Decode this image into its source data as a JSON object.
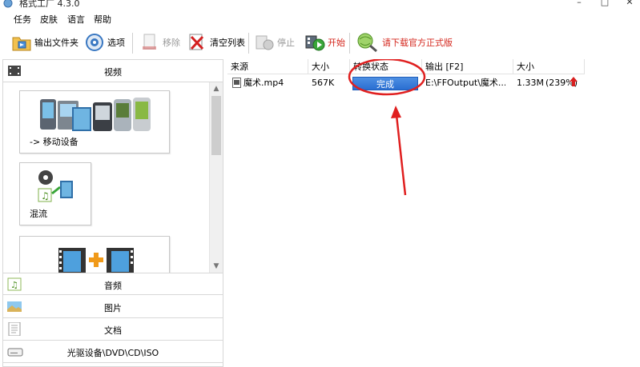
{
  "window": {
    "title": "格式工厂 4.3.0",
    "minimize_glyph": "–",
    "maximize_glyph": "□",
    "close_glyph": "✕"
  },
  "menu": [
    "任务",
    "皮肤",
    "语言",
    "帮助"
  ],
  "toolbar": {
    "output_folder": "输出文件夹",
    "options": "选项",
    "remove": "移除",
    "clear_list": "清空列表",
    "stop": "停止",
    "start": "开始",
    "download_official": "请下载官方正式版"
  },
  "sidebar": {
    "video_label": "视频",
    "tiles": [
      {
        "label": "-> 移动设备"
      },
      {
        "label": "混流"
      },
      {
        "label": ""
      }
    ],
    "scroll_up": "▲",
    "scroll_down": "▼",
    "categories": [
      {
        "label": "音频",
        "icon": "audio-icon"
      },
      {
        "label": "图片",
        "icon": "picture-icon"
      },
      {
        "label": "文档",
        "icon": "document-icon"
      },
      {
        "label": "光驱设备\\DVD\\CD\\ISO",
        "icon": "disc-drive-icon"
      }
    ]
  },
  "file_list": {
    "columns": [
      "来源",
      "大小",
      "转换状态",
      "输出 [F2]",
      "大小"
    ],
    "rows": [
      {
        "source": "魔术.mp4",
        "size": "567K",
        "status": "完成",
        "output": "E:\\FFOutput\\魔术....",
        "output_size": "1.33M",
        "ratio": "(239%)"
      }
    ]
  },
  "colors": {
    "status_fill": "#2a6ed1",
    "annotation": "#e02020",
    "disabled_text": "#9a9a9a",
    "promo_text": "#d4261c"
  }
}
